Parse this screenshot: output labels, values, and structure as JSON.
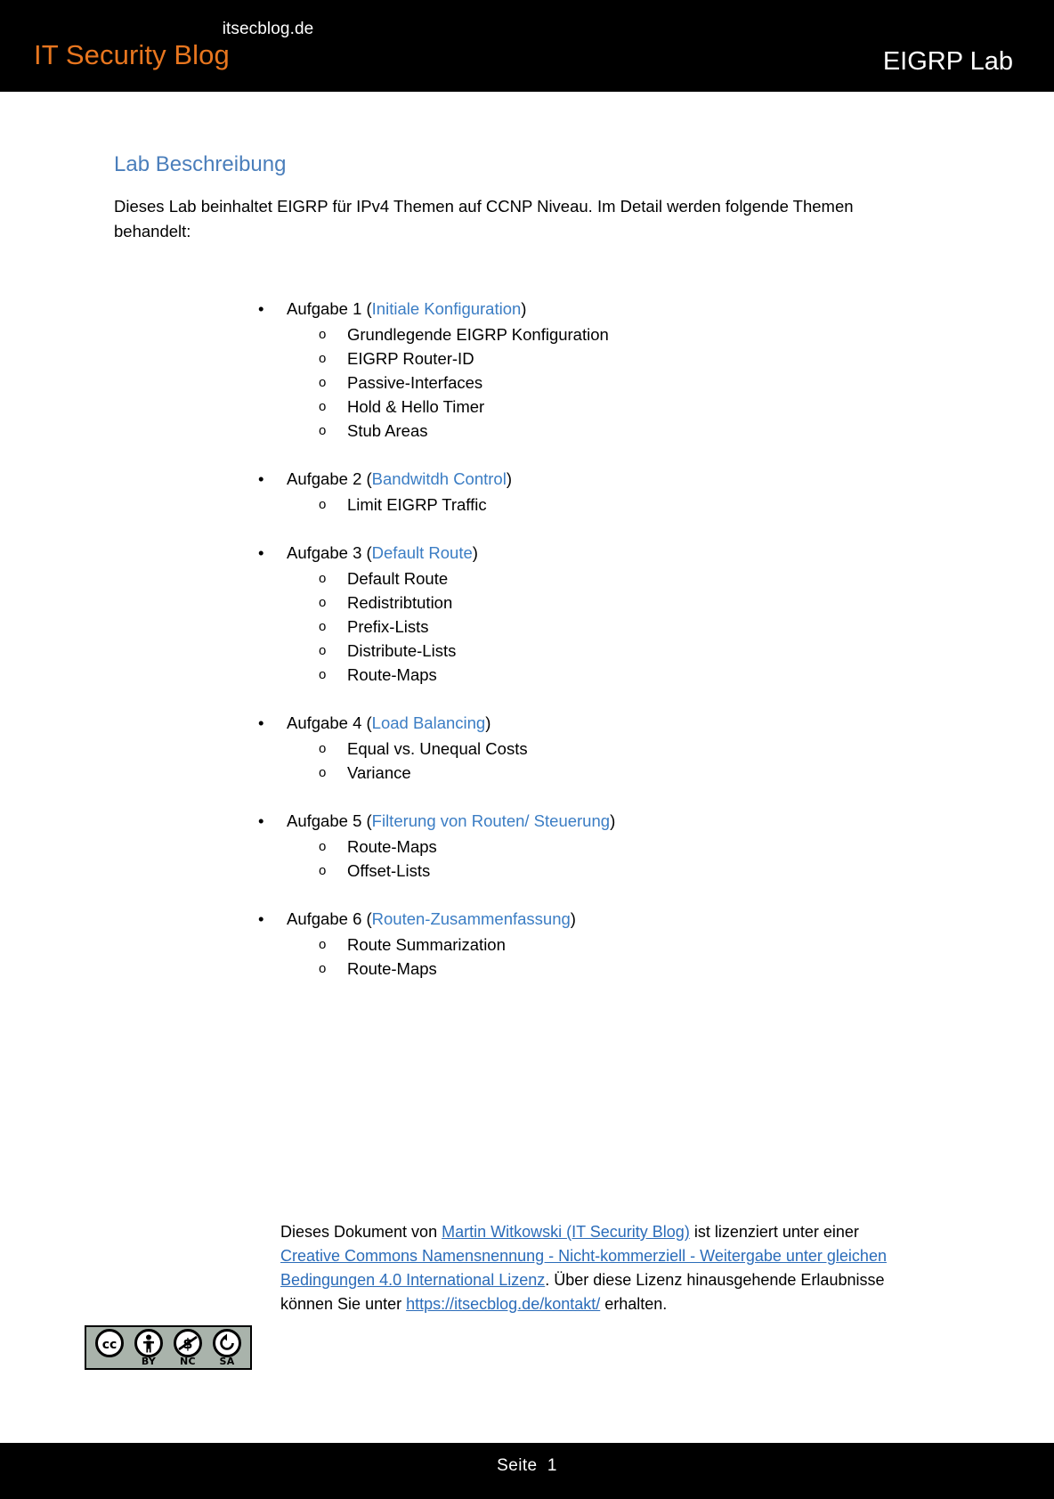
{
  "header": {
    "domain": "itsecblog.de",
    "brand": "IT Security Blog",
    "doc_title": "EIGRP Lab",
    "brand_color": "#E8761F",
    "bar_color": "#000000"
  },
  "main": {
    "section_heading": "Lab Beschreibung",
    "heading_color": "#4A7EBB",
    "intro": "Dieses Lab beinhaltet EIGRP für IPv4 Themen auf CCNP Niveau. Im Detail werden folgende Themen behandelt:",
    "link_color": "#3B7DC4",
    "bullet_glyph": "•",
    "sub_bullet_glyph": "o",
    "tasks": [
      {
        "prefix": "Aufgabe 1 (",
        "link": "Initiale Konfiguration",
        "suffix": ")",
        "subitems": [
          "Grundlegende EIGRP Konfiguration",
          "EIGRP Router-ID",
          "Passive-Interfaces",
          "Hold & Hello Timer",
          "Stub Areas"
        ]
      },
      {
        "prefix": "Aufgabe 2 (",
        "link": "Bandwitdh Control",
        "suffix": ")",
        "subitems": [
          "Limit EIGRP Traffic"
        ]
      },
      {
        "prefix": "Aufgabe 3 (",
        "link": "Default Route",
        "suffix": ")",
        "subitems": [
          "Default Route",
          "Redistribtution",
          "Prefix-Lists",
          "Distribute-Lists",
          "Route-Maps"
        ]
      },
      {
        "prefix": "Aufgabe 4 (",
        "link": "Load Balancing",
        "suffix": ")",
        "subitems": [
          "Equal vs. Unequal Costs",
          "Variance"
        ]
      },
      {
        "prefix": "Aufgabe 5 (",
        "link": "Filterung von Routen/ Steuerung",
        "suffix": ")",
        "subitems": [
          "Route-Maps",
          "Offset-Lists"
        ]
      },
      {
        "prefix": "Aufgabe 6 (",
        "link": "Routen-Zusammenfassung",
        "suffix": ")",
        "subitems": [
          "Route Summarization",
          "Route-Maps"
        ]
      }
    ]
  },
  "license": {
    "badge": {
      "cc_text": "CC",
      "labels": [
        "",
        "BY",
        "NC",
        "SA"
      ],
      "background": "#A9B3AB"
    },
    "text_part1": "Dieses Dokument von ",
    "link_author": "Martin Witkowski (IT Security Blog)",
    "text_part2": " ist lizenziert unter einer ",
    "link_license": "Creative Commons Namensnennung - Nicht-kommerziell - Weitergabe unter gleichen Bedingungen 4.0 International Lizenz",
    "text_part3": ". Über diese Lizenz hinausgehende Erlaubnisse können Sie unter ",
    "link_contact": "https://itsecblog.de/kontakt/",
    "text_part4": " erhalten.",
    "link_color": "#2B6CB9"
  },
  "footer": {
    "page_label": "Seite",
    "page_number": "1"
  }
}
